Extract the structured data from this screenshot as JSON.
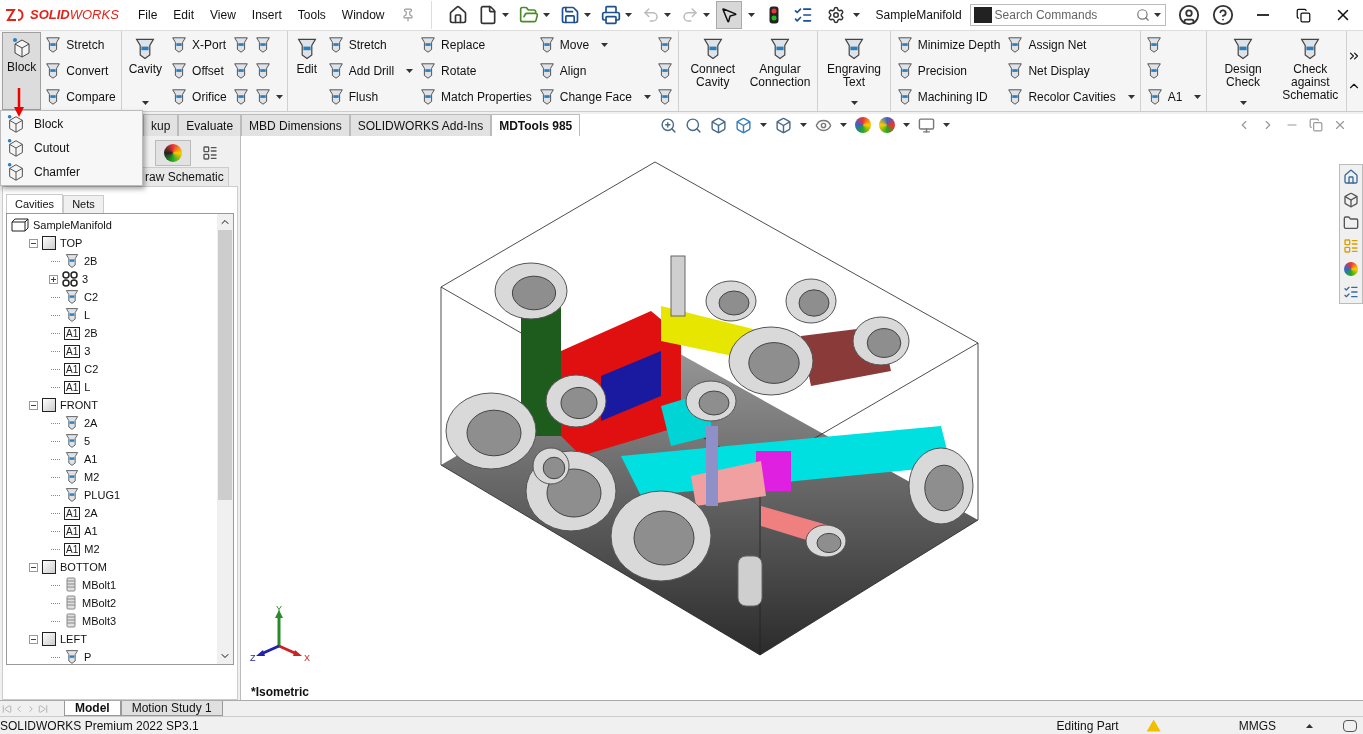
{
  "logo": "**SOLID**WORKS",
  "menu": [
    "File",
    "Edit",
    "View",
    "Insert",
    "Tools",
    "Window"
  ],
  "document_title": "SampleManifold",
  "search": {
    "placeholder": "Search Commands"
  },
  "ribbon": [
    {
      "columns": [
        [
          {
            "kind": "large",
            "label": "Block",
            "pressed": true
          }
        ],
        [
          {
            "kind": "small",
            "label": "Stretch"
          },
          {
            "kind": "small",
            "label": "Convert"
          },
          {
            "kind": "small",
            "label": "Compare"
          }
        ]
      ]
    },
    {
      "columns": [
        [
          {
            "kind": "large",
            "label": "Cavity",
            "dropdown": true
          }
        ],
        [
          {
            "kind": "small",
            "label": "X-Port"
          },
          {
            "kind": "small",
            "label": "Offset"
          },
          {
            "kind": "small",
            "label": "Orifice"
          }
        ],
        [
          {
            "kind": "icon"
          },
          {
            "kind": "icon"
          },
          {
            "kind": "icon"
          }
        ],
        [
          {
            "kind": "icon"
          },
          {
            "kind": "icon"
          },
          {
            "kind": "icon",
            "dropdown": true
          }
        ]
      ]
    },
    {
      "columns": [
        [
          {
            "kind": "large",
            "label": "Edit"
          }
        ],
        [
          {
            "kind": "small",
            "label": "Stretch"
          },
          {
            "kind": "small",
            "label": "Add Drill",
            "dropdown": true
          },
          {
            "kind": "small",
            "label": "Flush"
          }
        ],
        [
          {
            "kind": "small",
            "label": "Replace"
          },
          {
            "kind": "small",
            "label": "Rotate"
          },
          {
            "kind": "small",
            "label": "Match Properties"
          }
        ],
        [
          {
            "kind": "small",
            "label": "Move",
            "dropdown": true
          },
          {
            "kind": "small",
            "label": "Align"
          },
          {
            "kind": "small",
            "label": "Change Face",
            "dropdown": true
          }
        ],
        [
          {
            "kind": "icon"
          },
          {
            "kind": "icon"
          },
          {
            "kind": "icon"
          }
        ]
      ]
    },
    {
      "columns": [
        [
          {
            "kind": "large",
            "label": "Connect Cavity"
          }
        ],
        [
          {
            "kind": "large",
            "label": "Angular Connection"
          }
        ]
      ]
    },
    {
      "columns": [
        [
          {
            "kind": "large",
            "label": "Engraving Text",
            "dropdown": true
          }
        ]
      ]
    },
    {
      "columns": [
        [
          {
            "kind": "small",
            "label": "Minimize Depth"
          },
          {
            "kind": "small",
            "label": "Precision"
          },
          {
            "kind": "small",
            "label": "Machining ID"
          }
        ],
        [
          {
            "kind": "small",
            "label": "Assign Net"
          },
          {
            "kind": "small",
            "label": "Net Display"
          },
          {
            "kind": "small",
            "label": "Recolor Cavities",
            "dropdown": true
          }
        ]
      ]
    },
    {
      "columns": [
        [
          {
            "kind": "icon"
          },
          {
            "kind": "icon"
          },
          {
            "kind": "small",
            "label": "A1",
            "dropdown": true
          }
        ]
      ]
    },
    {
      "columns": [
        [
          {
            "kind": "large",
            "label": "Design Check",
            "dropdown": true
          }
        ],
        [
          {
            "kind": "large",
            "label": "Check against Schematic"
          }
        ]
      ]
    }
  ],
  "flyout_menu": [
    "Block",
    "Cutout",
    "Chamfer"
  ],
  "tabs": [
    {
      "label": "kup",
      "selected": false
    },
    {
      "label": "Evaluate",
      "selected": false
    },
    {
      "label": "MBD Dimensions",
      "selected": false
    },
    {
      "label": "SOLIDWORKS Add-Ins",
      "selected": false
    },
    {
      "label": "MDTools 985",
      "selected": true
    }
  ],
  "panel": {
    "schematic_tab": "raw Schematic",
    "tabs": [
      {
        "label": "Cavities",
        "selected": true
      },
      {
        "label": "Nets",
        "selected": false
      }
    ],
    "tree": [
      {
        "label": "SampleManifold",
        "kind": "root",
        "children": [
          {
            "label": "TOP",
            "kind": "face",
            "expanded": true,
            "children": [
              {
                "label": "2B",
                "kind": "cavity"
              },
              {
                "label": "3",
                "kind": "pattern",
                "expanded": false
              },
              {
                "label": "C2",
                "kind": "cavity"
              },
              {
                "label": "L",
                "kind": "cavity"
              },
              {
                "label": "2B",
                "kind": "engraving",
                "tag": "A1"
              },
              {
                "label": "3",
                "kind": "engraving",
                "tag": "A1"
              },
              {
                "label": "C2",
                "kind": "engraving",
                "tag": "A1"
              },
              {
                "label": "L",
                "kind": "engraving",
                "tag": "A1"
              }
            ]
          },
          {
            "label": "FRONT",
            "kind": "face",
            "expanded": true,
            "children": [
              {
                "label": "2A",
                "kind": "cavity"
              },
              {
                "label": "5",
                "kind": "cavity"
              },
              {
                "label": "A1",
                "kind": "cavity"
              },
              {
                "label": "M2",
                "kind": "cavity"
              },
              {
                "label": "PLUG1",
                "kind": "plug"
              },
              {
                "label": "2A",
                "kind": "engraving",
                "tag": "A1"
              },
              {
                "label": "A1",
                "kind": "engraving",
                "tag": "A1"
              },
              {
                "label": "M2",
                "kind": "engraving",
                "tag": "A1"
              }
            ]
          },
          {
            "label": "BOTTOM",
            "kind": "face",
            "expanded": true,
            "children": [
              {
                "label": "MBolt1",
                "kind": "bolt"
              },
              {
                "label": "MBolt2",
                "kind": "bolt"
              },
              {
                "label": "MBolt3",
                "kind": "bolt"
              }
            ]
          },
          {
            "label": "LEFT",
            "kind": "face",
            "expanded": true,
            "children": [
              {
                "label": "P",
                "kind": "cavity"
              }
            ]
          }
        ]
      }
    ]
  },
  "viewport": {
    "view_name": "*Isometric",
    "axes": [
      "X",
      "Y",
      "Z"
    ]
  },
  "bottom_tabs": [
    {
      "label": "Model",
      "selected": true
    },
    {
      "label": "Motion Study 1",
      "selected": false
    }
  ],
  "status_bar": {
    "product": "SOLIDWORKS Premium 2022 SP3.1",
    "mode": "Editing Part",
    "units": "MMGS"
  }
}
